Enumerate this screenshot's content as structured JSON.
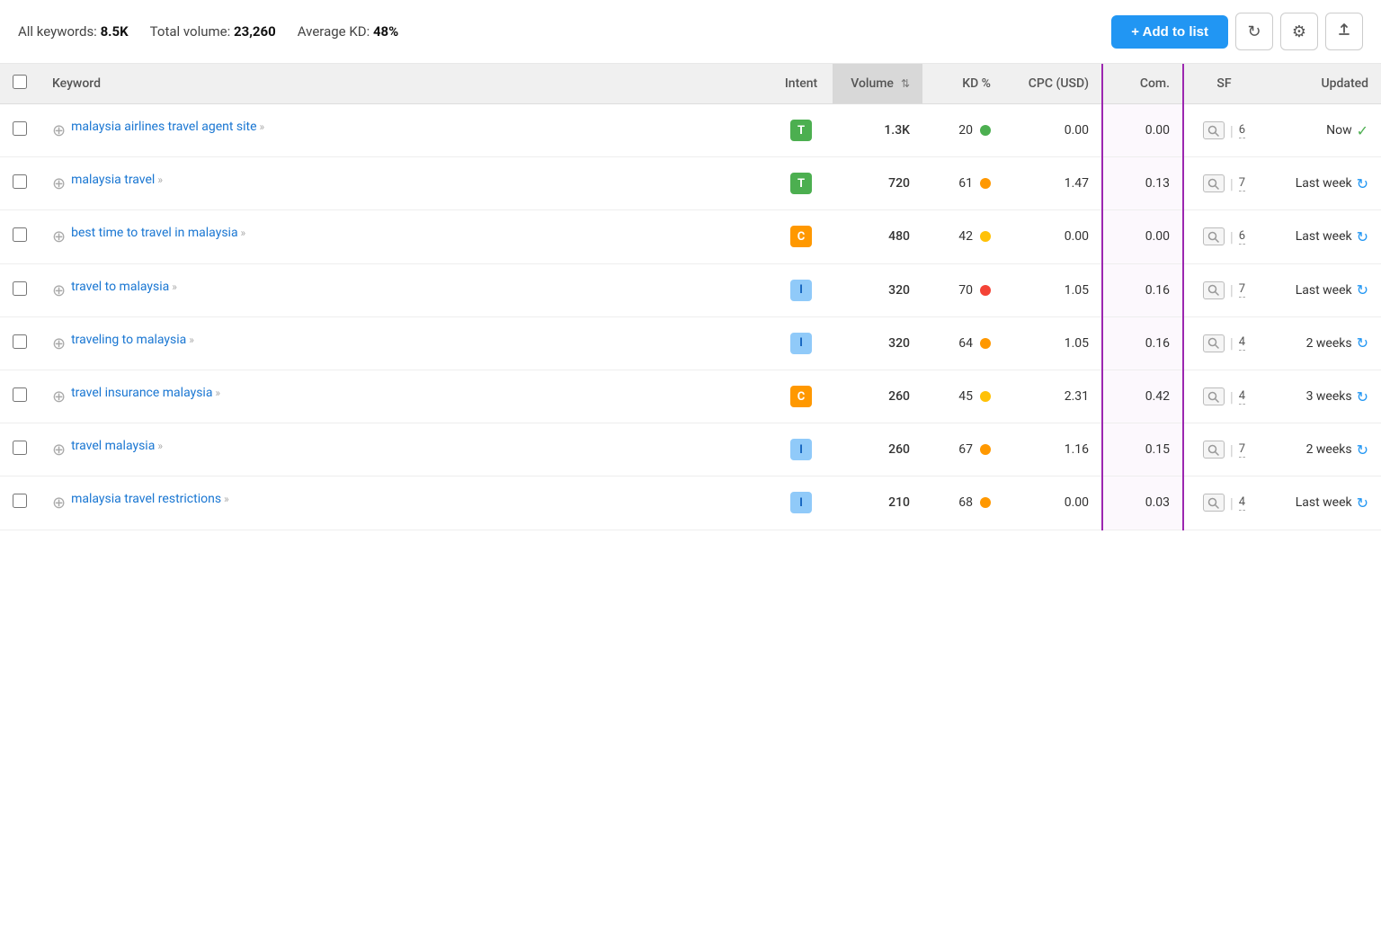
{
  "header": {
    "all_keywords_label": "All keywords:",
    "all_keywords_value": "8.5K",
    "total_volume_label": "Total volume:",
    "total_volume_value": "23,260",
    "avg_kd_label": "Average KD:",
    "avg_kd_value": "48%",
    "add_to_list_label": "+ Add to list",
    "refresh_icon": "↻",
    "settings_icon": "⚙",
    "export_icon": "↑"
  },
  "columns": {
    "keyword": "Keyword",
    "intent": "Intent",
    "volume": "Volume",
    "kd": "KD %",
    "cpc": "CPC (USD)",
    "com": "Com.",
    "sf": "SF",
    "updated": "Updated"
  },
  "rows": [
    {
      "id": 1,
      "keyword": "malaysia airlines travel agent site",
      "keyword_suffix": "»",
      "intent": "T",
      "intent_class": "intent-t",
      "volume": "1.3K",
      "kd": "20",
      "kd_dot": "dot-green",
      "cpc": "0.00",
      "com": "0.00",
      "sf_num": "6",
      "updated": "Now",
      "updated_icon": "check"
    },
    {
      "id": 2,
      "keyword": "malaysia travel",
      "keyword_suffix": "»",
      "intent": "T",
      "intent_class": "intent-t",
      "volume": "720",
      "kd": "61",
      "kd_dot": "dot-orange",
      "cpc": "1.47",
      "com": "0.13",
      "sf_num": "7",
      "updated": "Last week",
      "updated_icon": "refresh"
    },
    {
      "id": 3,
      "keyword": "best time to travel in malaysia",
      "keyword_suffix": "»",
      "intent": "C",
      "intent_class": "intent-c",
      "volume": "480",
      "kd": "42",
      "kd_dot": "dot-yellow",
      "cpc": "0.00",
      "com": "0.00",
      "sf_num": "6",
      "updated": "Last week",
      "updated_icon": "refresh"
    },
    {
      "id": 4,
      "keyword": "travel to malaysia",
      "keyword_suffix": "»",
      "intent": "I",
      "intent_class": "intent-i",
      "volume": "320",
      "kd": "70",
      "kd_dot": "dot-red",
      "cpc": "1.05",
      "com": "0.16",
      "sf_num": "7",
      "updated": "Last week",
      "updated_icon": "refresh"
    },
    {
      "id": 5,
      "keyword": "traveling to malaysia",
      "keyword_suffix": "»",
      "intent": "I",
      "intent_class": "intent-i",
      "volume": "320",
      "kd": "64",
      "kd_dot": "dot-orange",
      "cpc": "1.05",
      "com": "0.16",
      "sf_num": "4",
      "updated": "2 weeks",
      "updated_icon": "refresh"
    },
    {
      "id": 6,
      "keyword": "travel insurance malaysia",
      "keyword_suffix": "»",
      "intent": "C",
      "intent_class": "intent-c",
      "volume": "260",
      "kd": "45",
      "kd_dot": "dot-yellow",
      "cpc": "2.31",
      "com": "0.42",
      "sf_num": "4",
      "updated": "3 weeks",
      "updated_icon": "refresh"
    },
    {
      "id": 7,
      "keyword": "travel malaysia",
      "keyword_suffix": "»",
      "intent": "I",
      "intent_class": "intent-i",
      "volume": "260",
      "kd": "67",
      "kd_dot": "dot-orange",
      "cpc": "1.16",
      "com": "0.15",
      "sf_num": "7",
      "updated": "2 weeks",
      "updated_icon": "refresh"
    },
    {
      "id": 8,
      "keyword": "malaysia travel restrictions",
      "keyword_suffix": "»",
      "intent": "I",
      "intent_class": "intent-i",
      "volume": "210",
      "kd": "68",
      "kd_dot": "dot-orange",
      "cpc": "0.00",
      "com": "0.03",
      "sf_num": "4",
      "updated": "Last week",
      "updated_icon": "refresh"
    }
  ]
}
